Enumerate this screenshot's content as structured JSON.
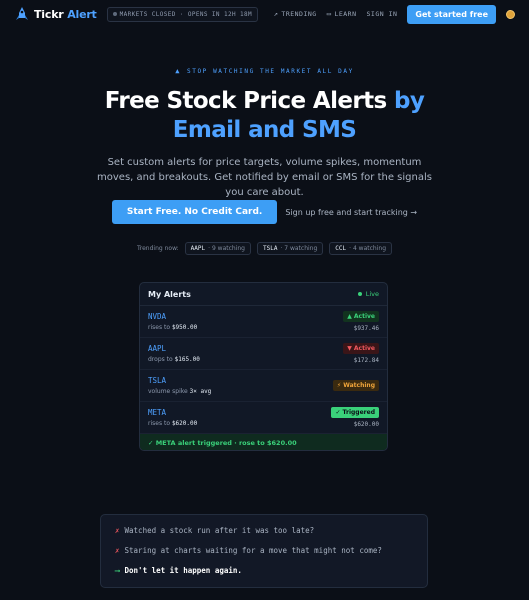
{
  "nav": {
    "logo_text_a": "Tickr",
    "logo_text_b": "Alert",
    "market_status": "MARKETS CLOSED · OPENS IN 12H 18M",
    "trending_label": "TRENDING",
    "learn_label": "LEARN",
    "signin_label": "SIGN IN",
    "cta_label": "Get started free"
  },
  "hero": {
    "eyebrow": "STOP WATCHING THE MARKET ALL DAY",
    "title_white": "Free Stock Price Alerts",
    "title_blue_1": "by",
    "title_blue_2": "Email and SMS",
    "subtitle": "Set custom alerts for price targets, volume spikes, momentum moves, and breakouts. Get notified by email or SMS for the signals you care about.",
    "cta_label": "Start Free. No Credit Card.",
    "secondary_label": "Sign up free and start tracking →",
    "trending_prefix": "Trending now:",
    "trending": [
      {
        "ticker": "AAPL",
        "watching": "· 9 watching"
      },
      {
        "ticker": "TSLA",
        "watching": "· 7 watching"
      },
      {
        "ticker": "CCL",
        "watching": "· 4 watching"
      }
    ]
  },
  "alerts_card": {
    "title": "My Alerts",
    "live_label": "Live",
    "rows": [
      {
        "ticker": "NVDA",
        "cond_text": "rises to",
        "cond_value": "$950.00",
        "badge": "▲ Active",
        "badge_type": "up",
        "price": "$937.46"
      },
      {
        "ticker": "AAPL",
        "cond_text": "drops to",
        "cond_value": "$165.00",
        "badge": "▼ Active",
        "badge_type": "down",
        "price": "$172.84"
      },
      {
        "ticker": "TSLA",
        "cond_text": "volume spike",
        "cond_value": "3× avg",
        "badge": "⚡ Watching",
        "badge_type": "watch",
        "price": ""
      },
      {
        "ticker": "META",
        "cond_text": "rises to",
        "cond_value": "$620.00",
        "badge": "✓ Triggered",
        "badge_type": "trig",
        "price": "$620.00"
      }
    ],
    "footer": "✓ META alert triggered · rose to $620.00"
  },
  "pain": {
    "line1": "Watched a stock run after it was too late?",
    "line2": "Staring at charts waiting for a move that might not come?",
    "line3": "Don't let it happen again.",
    "x_glyph": "✗",
    "arrow_glyph": "⟶"
  },
  "colors": {
    "accent": "#4ea1ff",
    "cta": "#3d9ef5",
    "green": "#3ad17a",
    "red": "#f0585e",
    "amber": "#f0a53a",
    "background": "#0b0f17"
  },
  "icons": [
    "rocket-logo-icon",
    "trend-icon",
    "book-icon",
    "coin-icon"
  ]
}
